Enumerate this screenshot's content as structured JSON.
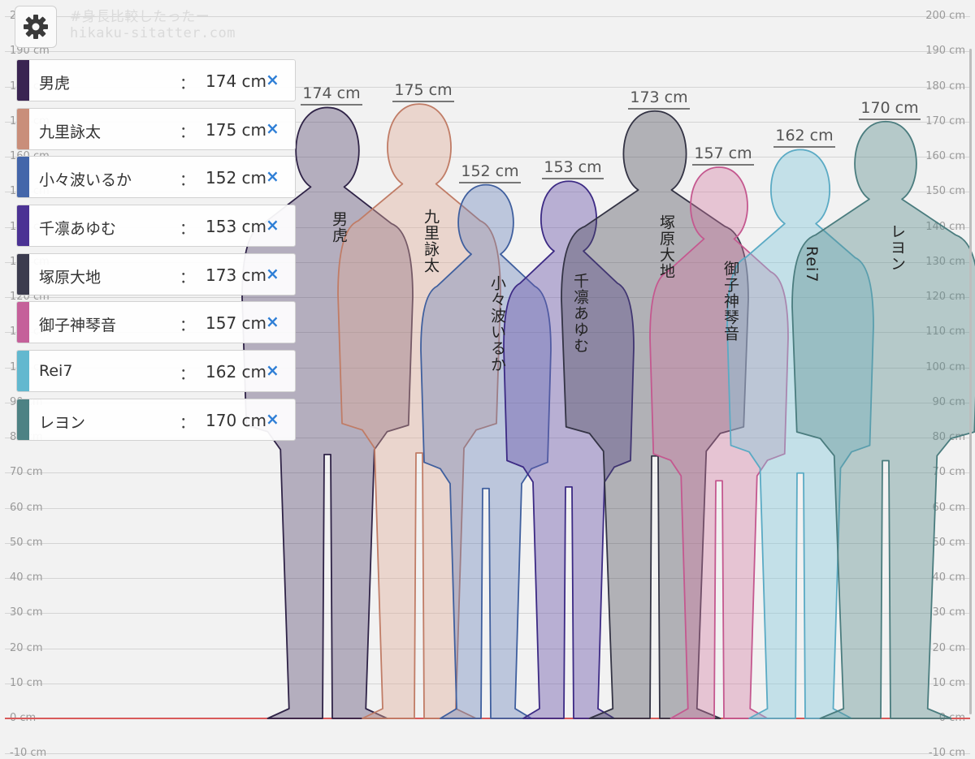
{
  "watermark": {
    "hashtag": "#身長比較したったー",
    "site": "hikaku-sitatter.com"
  },
  "scale": {
    "unit": "cm",
    "ticks": [
      "200 cm",
      "190 cm",
      "180 cm",
      "170 cm",
      "160 cm",
      "150 cm",
      "140 cm",
      "130 cm",
      "120 cm",
      "110 cm",
      "100 cm",
      "90 cm",
      "80 cm",
      "70 cm",
      "60 cm",
      "50 cm",
      "40 cm",
      "30 cm",
      "20 cm",
      "10 cm",
      "0 cm",
      "-10 cm"
    ],
    "baseline_color": "#d95a5a"
  },
  "settings": {
    "icon": "gear-icon"
  },
  "characters": [
    {
      "name": "男虎",
      "colon": "：",
      "height": "174 cm",
      "value": 174,
      "color": "#3a2452",
      "fill": "rgba(80,64,104,0.38)",
      "stroke": "#2f2347",
      "remove": "×",
      "label_top": "174 cm"
    },
    {
      "name": "九里詠太",
      "colon": "：",
      "height": "175 cm",
      "value": 175,
      "color": "#c98e7a",
      "fill": "rgba(222,170,150,0.40)",
      "stroke": "#c07c66",
      "remove": "×",
      "label_top": "175 cm"
    },
    {
      "name": "小々波いるか",
      "colon": "：",
      "height": "152 cm",
      "value": 152,
      "color": "#4466aa",
      "fill": "rgba(100,126,184,0.38)",
      "stroke": "#3f5f9e",
      "remove": "×",
      "label_top": "152 cm"
    },
    {
      "name": "千凛あゆむ",
      "colon": "：",
      "height": "153 cm",
      "value": 153,
      "color": "#4b3294",
      "fill": "rgba(104,84,170,0.42)",
      "stroke": "#3c2a84",
      "remove": "×",
      "label_top": "153 cm"
    },
    {
      "name": "塚原大地",
      "colon": "：",
      "height": "173 cm",
      "value": 173,
      "color": "#3b3b4e",
      "fill": "rgba(72,72,84,0.38)",
      "stroke": "#333344",
      "remove": "×",
      "label_top": "173 cm"
    },
    {
      "name": "御子神琴音",
      "colon": "：",
      "height": "157 cm",
      "value": 157,
      "color": "#c5609a",
      "fill": "rgba(210,120,160,0.38)",
      "stroke": "#c4588f",
      "remove": "×",
      "label_top": "157 cm"
    },
    {
      "name": "Rei7",
      "colon": "：",
      "height": "162 cm",
      "value": 162,
      "color": "#62b8cf",
      "fill": "rgba(130,200,220,0.42)",
      "stroke": "#5aaac4",
      "remove": "×",
      "label_top": "162 cm"
    },
    {
      "name": "レヨン",
      "colon": "：",
      "height": "170 cm",
      "value": 170,
      "color": "#4d8284",
      "fill": "rgba(90,140,140,0.40)",
      "stroke": "#4a7c7e",
      "remove": "×",
      "label_top": "170 cm"
    }
  ]
}
